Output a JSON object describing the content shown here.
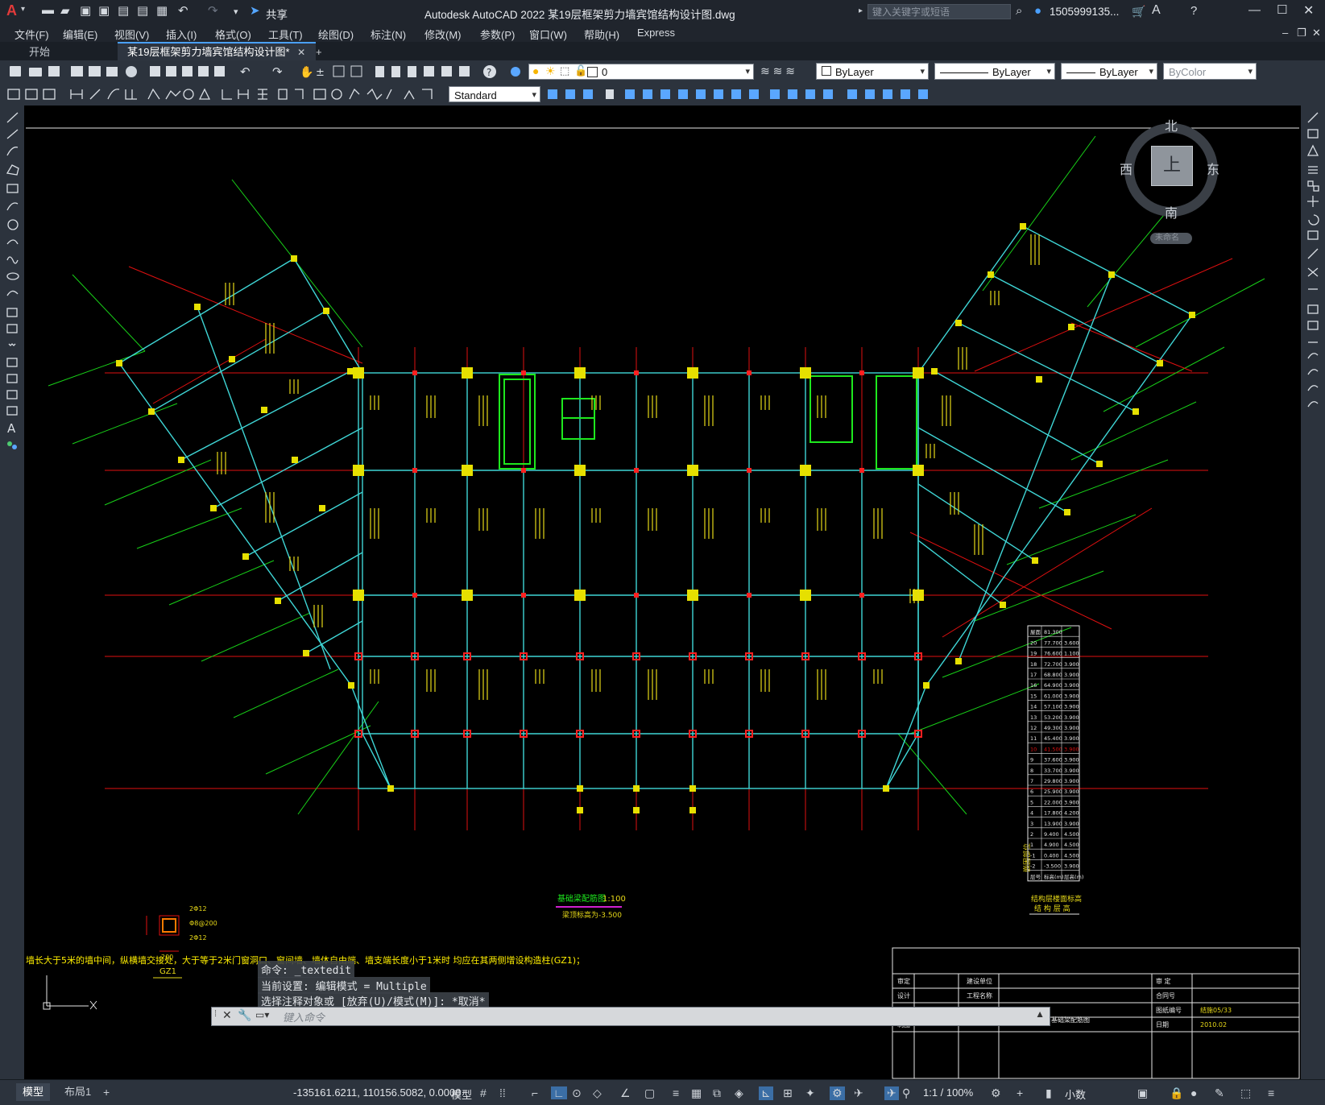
{
  "app": {
    "logo": "A",
    "title": "Autodesk AutoCAD 2022    某19层框架剪力墙宾馆结构设计图.dwg",
    "share": "共享",
    "search_placeholder": "键入关键字或短语",
    "user": "1505999135...",
    "window_controls": [
      "minimize-icon",
      "maximize-icon",
      "close-icon"
    ]
  },
  "menu": [
    "文件(F)",
    "编辑(E)",
    "视图(V)",
    "插入(I)",
    "格式(O)",
    "工具(T)",
    "绘图(D)",
    "标注(N)",
    "修改(M)",
    "参数(P)",
    "窗口(W)",
    "帮助(H)",
    "Express"
  ],
  "tabs": {
    "start": "开始",
    "active": "某19层框架剪力墙宾馆结构设计图*",
    "close": "✕",
    "add": "+"
  },
  "toolbar": {
    "layer": "0",
    "color": "ByLayer",
    "linetype": "ByLayer",
    "lineweight": "ByLayer",
    "plotstyle": "ByColor",
    "textstyle": "Standard"
  },
  "viewcube": {
    "north": "北",
    "south": "南",
    "east": "东",
    "west": "西",
    "face": "上",
    "wcs": "未命名"
  },
  "drawing": {
    "plan_title": "基础梁配筋图",
    "plan_scale": "1:100",
    "plan_elev": "梁顶标高为-3.500",
    "gz_label": "GZ1",
    "note": "墙长大于5米的墙中间，纵横墙交接处，大于等于2米门窗洞口、窗间墙、墙体自由端、墙支端长度小于1米时 均应在其两侧增设构造柱(GZ1)；",
    "table_title": "结构层楼面标高",
    "table_subtitle": "结 构 层 高",
    "floor_rows": [
      [
        "屋面",
        "81.300",
        ""
      ],
      [
        "20",
        "77.700",
        "3.600"
      ],
      [
        "19",
        "76.600",
        "1.100"
      ],
      [
        "18",
        "72.700",
        "3.900"
      ],
      [
        "17",
        "68.800",
        "3.900"
      ],
      [
        "16",
        "64.900",
        "3.900"
      ],
      [
        "15",
        "61.000",
        "3.900"
      ],
      [
        "14",
        "57.100",
        "3.900"
      ],
      [
        "13",
        "53.200",
        "3.900"
      ],
      [
        "12",
        "49.300",
        "3.900"
      ],
      [
        "11",
        "45.400",
        "3.900"
      ],
      [
        "10",
        "41.500",
        "3.900"
      ],
      [
        "9",
        "37.600",
        "3.900"
      ],
      [
        "8",
        "33.700",
        "3.900"
      ],
      [
        "7",
        "29.800",
        "3.900"
      ],
      [
        "6",
        "25.900",
        "3.900"
      ],
      [
        "5",
        "22.000",
        "3.900"
      ],
      [
        "4",
        "17.800",
        "4.200"
      ],
      [
        "3",
        "13.900",
        "3.900"
      ],
      [
        "2",
        "9.400",
        "4.500"
      ],
      [
        "1",
        "4.900",
        "4.500"
      ],
      [
        "-1",
        "0.400",
        "4.500"
      ],
      [
        "-2",
        "-3.500",
        "3.900"
      ],
      [
        "层号",
        "标高(m)",
        "层高(m)"
      ]
    ],
    "side_label": "嵌固部位",
    "titleblock": {
      "r1": [
        "审定",
        "",
        "建设单位",
        "",
        "审 定",
        ""
      ],
      "r2": [
        "设计",
        "",
        "工程名称",
        "",
        "合同号",
        ""
      ],
      "r3": [
        "校对",
        "",
        "",
        "基础梁配筋图",
        "图纸编号",
        "结施05/33"
      ],
      "r4": [
        "制图",
        "",
        "",
        "",
        "日期",
        "2010.02"
      ]
    }
  },
  "command": {
    "history": [
      "命令: _textedit",
      "当前设置: 编辑模式 = Multiple",
      "选择注释对象或 [放弃(U)/模式(M)]: *取消*"
    ],
    "placeholder": "键入命令"
  },
  "status": {
    "model_tab": "模型",
    "layout_tab": "布局1",
    "add_tab": "+",
    "coords": "-135161.6211, 110156.5082, 0.0000",
    "space": "模型",
    "scale": "1:1 / 100%",
    "units": "小数"
  }
}
